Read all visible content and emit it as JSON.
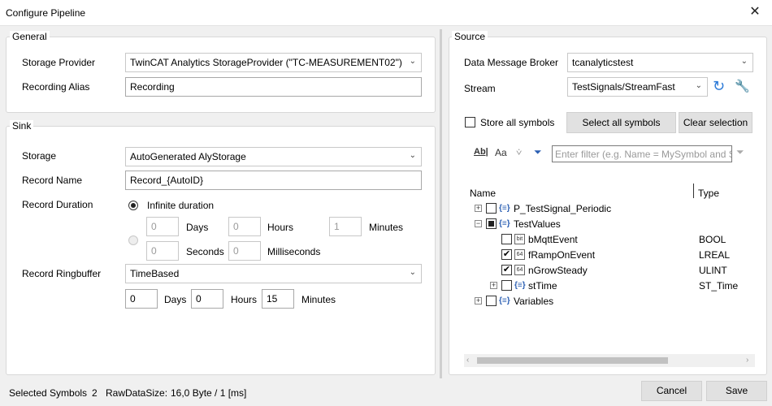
{
  "window": {
    "title": "Configure Pipeline",
    "close_icon": "✕"
  },
  "general": {
    "legend": "General",
    "storage_provider_label": "Storage Provider",
    "storage_provider_value": "TwinCAT Analytics StorageProvider (\"TC-MEASUREMENT02\")",
    "recording_alias_label": "Recording Alias",
    "recording_alias_value": "Recording"
  },
  "sink": {
    "legend": "Sink",
    "storage_label": "Storage",
    "storage_value": "AutoGenerated AlyStorage",
    "record_name_label": "Record Name",
    "record_name_value": "Record_{AutoID}",
    "record_duration_label": "Record Duration",
    "infinite_label": "Infinite duration",
    "days_value": "0",
    "days_label": "Days",
    "hours_value": "0",
    "hours_label": "Hours",
    "minutes_value": "1",
    "minutes_label": "Minutes",
    "seconds_value": "0",
    "seconds_label": "Seconds",
    "ms_value": "0",
    "ms_label": "Milliseconds",
    "ringbuffer_label": "Record Ringbuffer",
    "ringbuffer_value": "TimeBased",
    "rb_days_value": "0",
    "rb_days_label": "Days",
    "rb_hours_value": "0",
    "rb_hours_label": "Hours",
    "rb_minutes_value": "15",
    "rb_minutes_label": "Minutes"
  },
  "source": {
    "legend": "Source",
    "broker_label": "Data Message Broker",
    "broker_value": "tcanalyticstest",
    "stream_label": "Stream",
    "stream_value": "TestSignals/StreamFast",
    "store_all_label": "Store all symbols",
    "select_all_button": "Select all symbols",
    "clear_selection_button": "Clear selection",
    "filter_placeholder": "Enter filter (e.g. Name = MySymbol and S",
    "col_name": "Name",
    "col_type": "Type",
    "tree": [
      {
        "name": "P_TestSignal_Periodic",
        "type": "",
        "expander": "+"
      },
      {
        "name": "TestValues",
        "type": "",
        "expander": "−"
      },
      {
        "name": "bMqttEvent",
        "type": "BOOL",
        "icon": "bit"
      },
      {
        "name": "fRampOnEvent",
        "type": "LREAL",
        "icon": "64"
      },
      {
        "name": "nGrowSteady",
        "type": "ULINT",
        "icon": "64"
      },
      {
        "name": "stTime",
        "type": "ST_Time",
        "expander": "+"
      },
      {
        "name": "Variables",
        "type": "",
        "expander": "+"
      }
    ]
  },
  "status": {
    "selected_symbols_label": "Selected Symbols",
    "selected_symbols_value": "2",
    "raw_data_label": "RawDataSize:",
    "raw_data_value": "16,0 Byte / 1 [ms]"
  },
  "footer": {
    "cancel_button": "Cancel",
    "save_button": "Save"
  }
}
